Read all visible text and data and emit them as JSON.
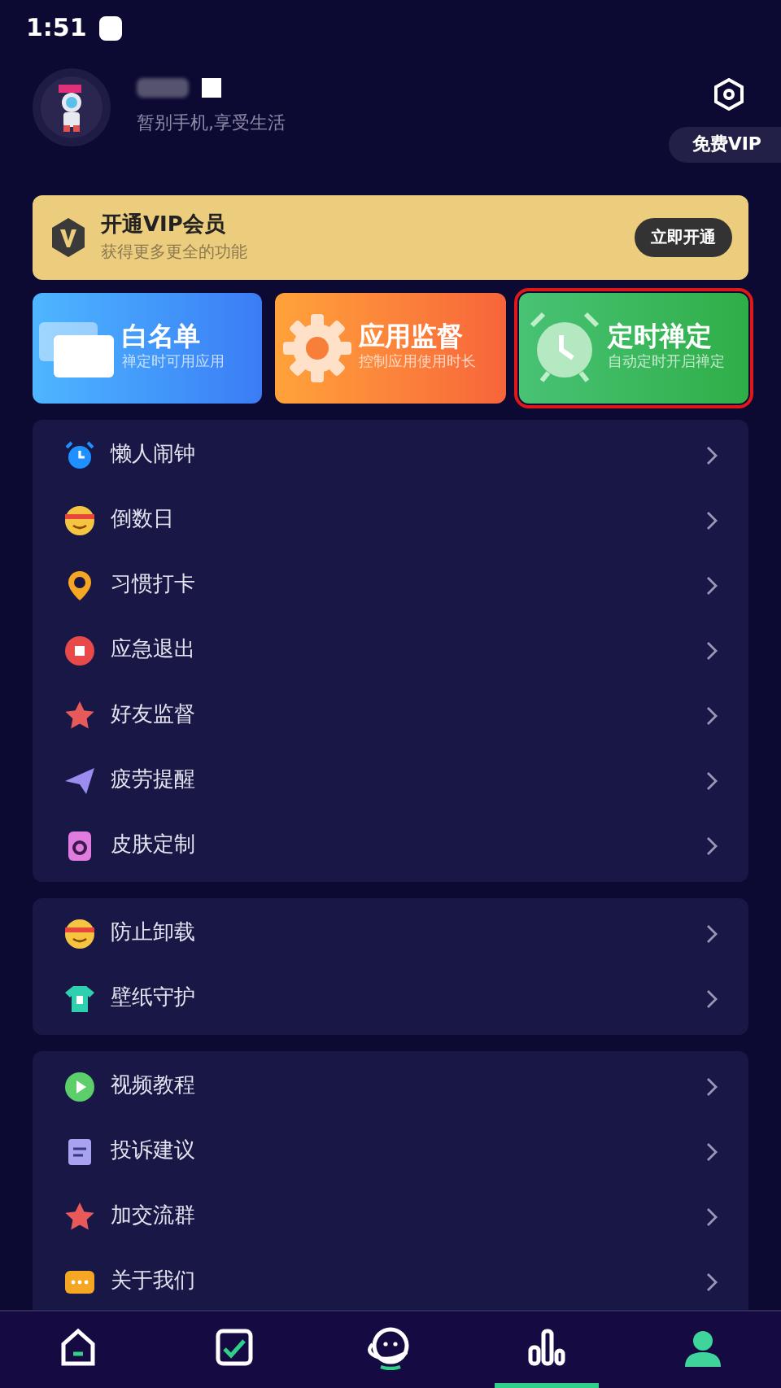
{
  "status_bar": {
    "time": "1:51"
  },
  "profile": {
    "tagline": "暂别手机,享受生活",
    "vip_pill": "免费VIP"
  },
  "vip_banner": {
    "title": "开通VIP会员",
    "subtitle": "获得更多更全的功能",
    "button": "立即开通"
  },
  "feature_cards": [
    {
      "kind": "folders",
      "title": "白名单",
      "subtitle": "禅定时可用应用",
      "highlighted": false
    },
    {
      "kind": "gear",
      "title": "应用监督",
      "subtitle": "控制应用使用时长",
      "highlighted": false
    },
    {
      "kind": "alarm",
      "title": "定时禅定",
      "subtitle": "自动定时开启禅定",
      "highlighted": true
    }
  ],
  "menu_groups": [
    {
      "items": [
        {
          "kind": "alarm",
          "label": "懒人闹钟"
        },
        {
          "kind": "face",
          "label": "倒数日"
        },
        {
          "kind": "pin",
          "label": "习惯打卡"
        },
        {
          "kind": "stop",
          "label": "应急退出"
        },
        {
          "kind": "star",
          "label": "好友监督"
        },
        {
          "kind": "plane",
          "label": "疲劳提醒"
        },
        {
          "kind": "skin",
          "label": "皮肤定制"
        }
      ]
    },
    {
      "items": [
        {
          "kind": "face",
          "label": "防止卸载"
        },
        {
          "kind": "shirt",
          "label": "壁纸守护"
        }
      ]
    },
    {
      "items": [
        {
          "kind": "play",
          "label": "视频教程"
        },
        {
          "kind": "note",
          "label": "投诉建议"
        },
        {
          "kind": "star",
          "label": "加交流群"
        },
        {
          "kind": "chat",
          "label": "关于我们"
        }
      ]
    }
  ],
  "bottom_nav": [
    {
      "kind": "home",
      "selected": false
    },
    {
      "kind": "check",
      "selected": false
    },
    {
      "kind": "planet",
      "selected": false
    },
    {
      "kind": "stats",
      "selected": true
    },
    {
      "kind": "person",
      "selected": false
    }
  ]
}
